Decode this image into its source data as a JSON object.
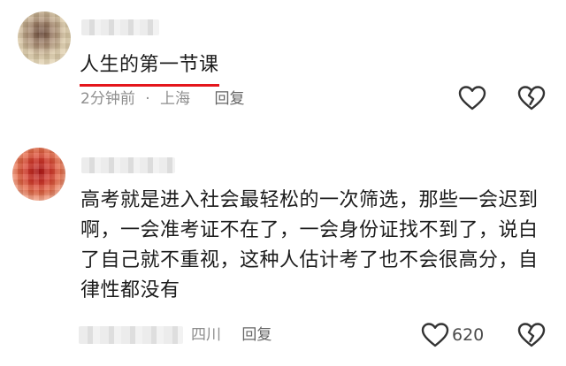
{
  "comments": [
    {
      "text": "人生的第一节课",
      "time": "2分钟前",
      "separator": "·",
      "location": "上海",
      "reply_label": "回复",
      "like_count": ""
    },
    {
      "text": "高考就是进入社会最轻松的一次筛选，那些一会迟到啊，一会准考证不在了，一会身份证找不到了，说白了自己就不重视，这种人估计考了也不会很高分，自律性都没有",
      "location": "四川",
      "reply_label": "回复",
      "like_count": "620"
    }
  ],
  "icons": {
    "like": "heart-outline-icon",
    "dislike": "broken-heart-icon"
  },
  "colors": {
    "highlight_underline": "#e4161c",
    "meta_text": "#8e8e8e",
    "body_text": "#1c1c1c"
  }
}
